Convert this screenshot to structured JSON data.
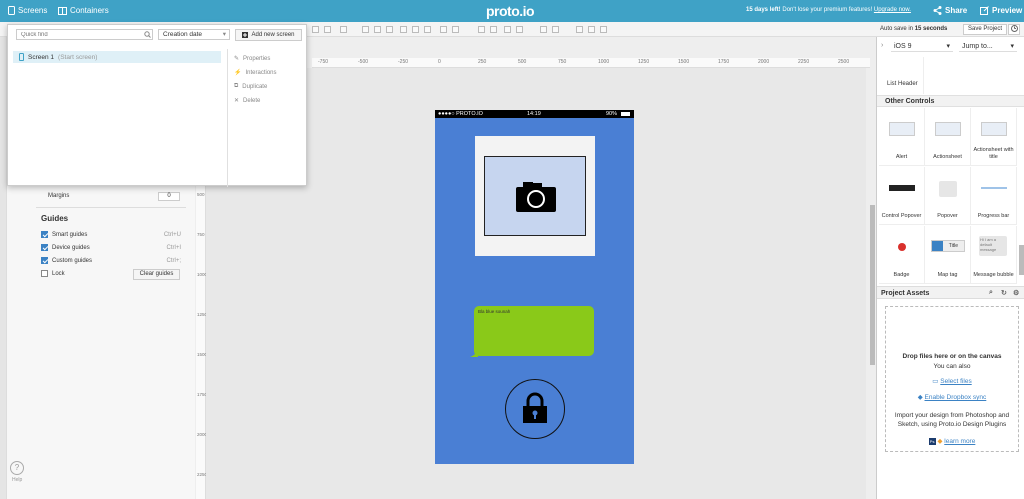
{
  "topbar": {
    "screens_label": "Screens",
    "containers_label": "Containers",
    "logo": "proto.io",
    "trial_bold": "15 days left!",
    "trial_text": " Don't lose your premium features!",
    "trial_link": "Upgrade now.",
    "share_label": "Share",
    "preview_label": "Preview",
    "bg_color": "#3fa2c6"
  },
  "toolbar": {
    "autosave_text": "Auto save in",
    "autosave_secs": "15 seconds",
    "save_label": "Save Project"
  },
  "screens_dropdown": {
    "search_placeholder": "Quick find",
    "sort_selected": "Creation date",
    "add_label": "Add new screen",
    "screen_name": "Screen 1",
    "screen_sub": "(Start screen)",
    "context_menu": [
      "Properties",
      "Interactions",
      "Duplicate",
      "Delete"
    ]
  },
  "left_panel": {
    "margins_label": "Margins",
    "margins_value": "0",
    "guides_title": "Guides",
    "guides": [
      {
        "label": "Smart guides",
        "shortcut": "Ctrl+U",
        "checked": true
      },
      {
        "label": "Device guides",
        "shortcut": "Ctrl+I",
        "checked": true
      },
      {
        "label": "Custom guides",
        "shortcut": "Ctrl+;",
        "checked": true
      },
      {
        "label": "Lock",
        "shortcut": "",
        "checked": false
      }
    ],
    "clear_guides_label": "Clear guides",
    "help_label": "Help"
  },
  "rulers": {
    "top_ticks": [
      "-750",
      "-500",
      "-250",
      "0",
      "250",
      "500",
      "750",
      "1000",
      "1250",
      "1500",
      "1750",
      "2000",
      "2250",
      "2500"
    ],
    "left_ticks": [
      "500",
      "750",
      "1000",
      "1250",
      "1500",
      "1750",
      "2000",
      "2250"
    ]
  },
  "phone": {
    "carrier": "●●●●○ PROTO.IO",
    "time": "14:19",
    "battery": "90%",
    "bubble_text": "Bla blue sounah",
    "bg_color": "#4a7fd4",
    "bubble_color": "#8ac919"
  },
  "right_panel": {
    "ios_selected": "iOS 9",
    "jump_label": "Jump to...",
    "list_header_label": "List Header",
    "other_controls_title": "Other Controls",
    "controls": [
      "Alert",
      "Actionsheet",
      "Actionsheet with title",
      "Control Popover",
      "Popover",
      "Progress bar",
      "Badge",
      "Map tag",
      "Message bubble"
    ],
    "maptag_title": "Title",
    "message_preview": "Hi I am a default message",
    "assets_title": "Project Assets",
    "drop_title": "Drop files here or on the canvas",
    "drop_also": "You can also",
    "select_files": "Select files",
    "dropbox_sync": "Enable Dropbox sync",
    "import_text": "Import your design from Photoshop and Sketch, using Proto.io Design Plugins",
    "learn_more": "learn more"
  }
}
